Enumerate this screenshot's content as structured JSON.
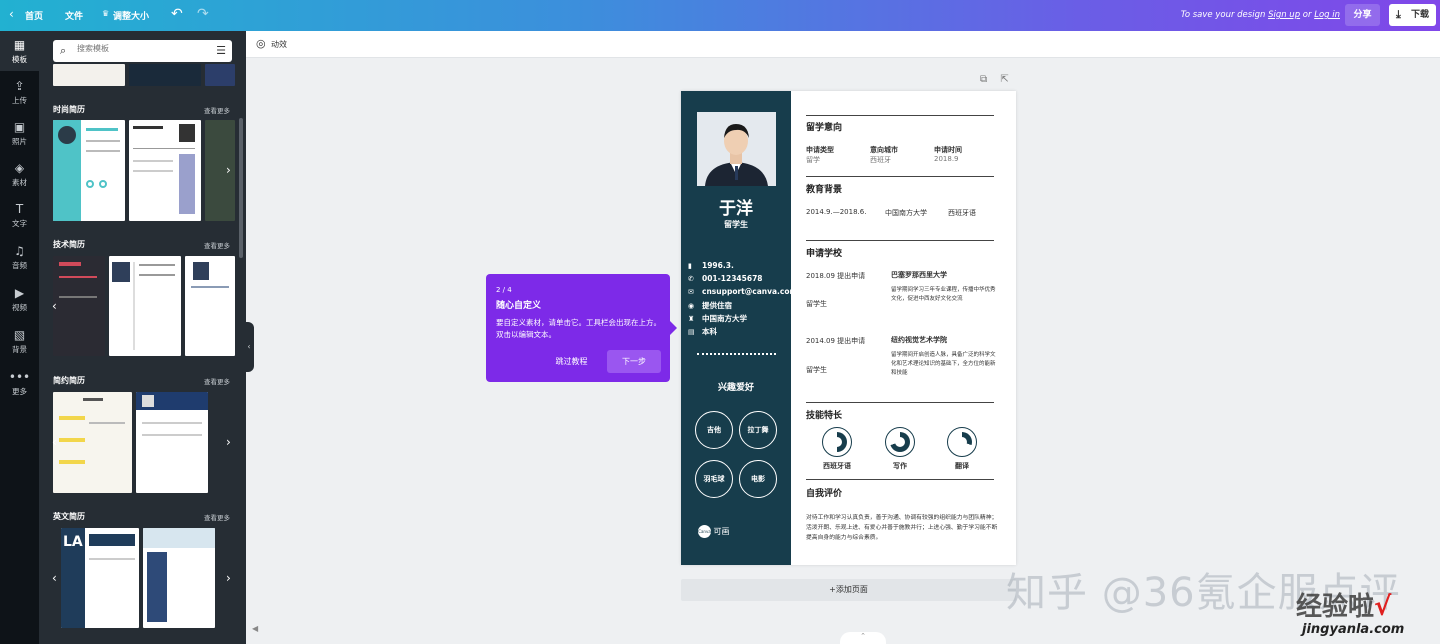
{
  "topbar": {
    "home": "首页",
    "file": "文件",
    "resize": "调整大小",
    "save_prefix": "To save your design",
    "sign_up": "Sign up",
    "or": "or",
    "log_in": "Log in",
    "share": "分享",
    "download": "下载"
  },
  "rail": [
    {
      "icon": "▦",
      "label": "模板"
    },
    {
      "icon": "⇪",
      "label": "上传"
    },
    {
      "icon": "▣",
      "label": "照片"
    },
    {
      "icon": "◈",
      "label": "素材"
    },
    {
      "icon": "T",
      "label": "文字"
    },
    {
      "icon": "♫",
      "label": "音频"
    },
    {
      "icon": "▶",
      "label": "视频"
    },
    {
      "icon": "▧",
      "label": "背景"
    },
    {
      "icon": "•••",
      "label": "更多"
    }
  ],
  "panel": {
    "search_placeholder": "搜索模板",
    "see_more": "查看更多",
    "sections": [
      "时尚简历",
      "技术简历",
      "简约简历",
      "英文简历"
    ]
  },
  "animbar": {
    "label": "动效"
  },
  "resume": {
    "name": "于洋",
    "role": "留学生",
    "info": [
      {
        "icon": "▮",
        "text": "1996.3."
      },
      {
        "icon": "✆",
        "text": "001-12345678"
      },
      {
        "icon": "✉",
        "text": "cnsupport@canva.com"
      },
      {
        "icon": "◉",
        "text": "提供住宿"
      },
      {
        "icon": "♜",
        "text": "中国南方大学"
      },
      {
        "icon": "▤",
        "text": "本科"
      }
    ],
    "hobby_title": "兴趣爱好",
    "hobbies": [
      "吉他",
      "拉丁舞",
      "羽毛球",
      "电影"
    ],
    "logo_text": "Canva",
    "logo_sig": "可画",
    "intent": {
      "heading": "留学意向",
      "cols": [
        {
          "label": "申请类型",
          "value": "留学"
        },
        {
          "label": "意向城市",
          "value": "西班牙"
        },
        {
          "label": "申请时间",
          "value": "2018.9"
        }
      ]
    },
    "education": {
      "heading": "教育背景",
      "period": "2014.9.—2018.6.",
      "school": "中国南方大学",
      "major": "西班牙语"
    },
    "schools": {
      "heading": "申请学校",
      "items": [
        {
          "date": "2018.09 提出申请",
          "school": "巴塞罗那西里大学",
          "type": "留学生",
          "desc": "留学期间学习三年专业课程，传播中华优秀文化，促进中西友好文化交流"
        },
        {
          "date": "2014.09 提出申请",
          "school": "纽约视觉艺术学院",
          "type": "留学生",
          "desc": "留学期间开启创造人脉，具备广泛的科学文化和艺术理论知识的基础下，全方位的能新和技能"
        }
      ]
    },
    "skills": {
      "heading": "技能特长",
      "items": [
        {
          "label": "西班牙语",
          "level": 0.5
        },
        {
          "label": "写作",
          "level": 0.7
        },
        {
          "label": "翻译",
          "level": 0.3
        }
      ]
    },
    "self": {
      "heading": "自我评价",
      "text": "对待工作和学习认真负责，善于沟通、协调有较强的组织能力与团队精神；活泼开朗、乐观上进、有爱心并善于施教并行；上进心强、勤于学习能不断提高自身的能力与综合素质。"
    }
  },
  "tooltip": {
    "step": "2 / 4",
    "title": "随心自定义",
    "body": "要自定义素材，请单击它。工具栏会出现在上方。双击以编辑文本。",
    "skip": "跳过教程",
    "next": "下一步"
  },
  "add_page": "+添加页面",
  "watermark": {
    "line1": "知乎 @36氪企服点评",
    "line2": "经验啦",
    "check": "√",
    "url": "jingyanla.com"
  },
  "colors": {
    "accent": "#7d2ae8",
    "resume_dark": "#173d4c",
    "panel": "#262d34",
    "rail": "#0e1318"
  }
}
